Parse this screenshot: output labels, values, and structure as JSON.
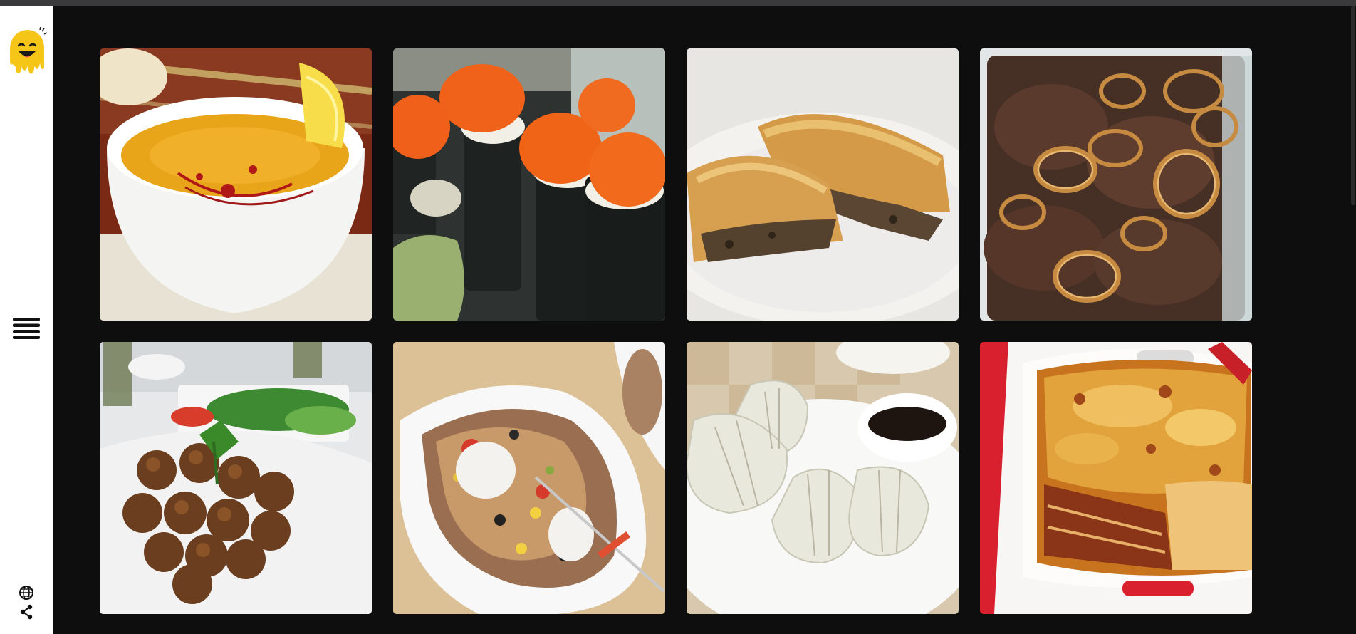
{
  "sidebar": {
    "logo_icon": "smiley-drip-logo",
    "menu_icon": "hamburger-menu-icon",
    "language_icon": "globe-icon",
    "share_icon": "share-icon",
    "accent_color": "#f5c518"
  },
  "gallery": {
    "tiles": [
      {
        "subject": "lentil-soup"
      },
      {
        "subject": "sushi-rolls"
      },
      {
        "subject": "meat-pie"
      },
      {
        "subject": "liver-with-onions"
      },
      {
        "subject": "falafel"
      },
      {
        "subject": "stuffed-baked-potato"
      },
      {
        "subject": "dumplings"
      },
      {
        "subject": "lasagna"
      }
    ]
  },
  "colors": {
    "background": "#0e0e0e",
    "sidebar": "#ffffff"
  }
}
